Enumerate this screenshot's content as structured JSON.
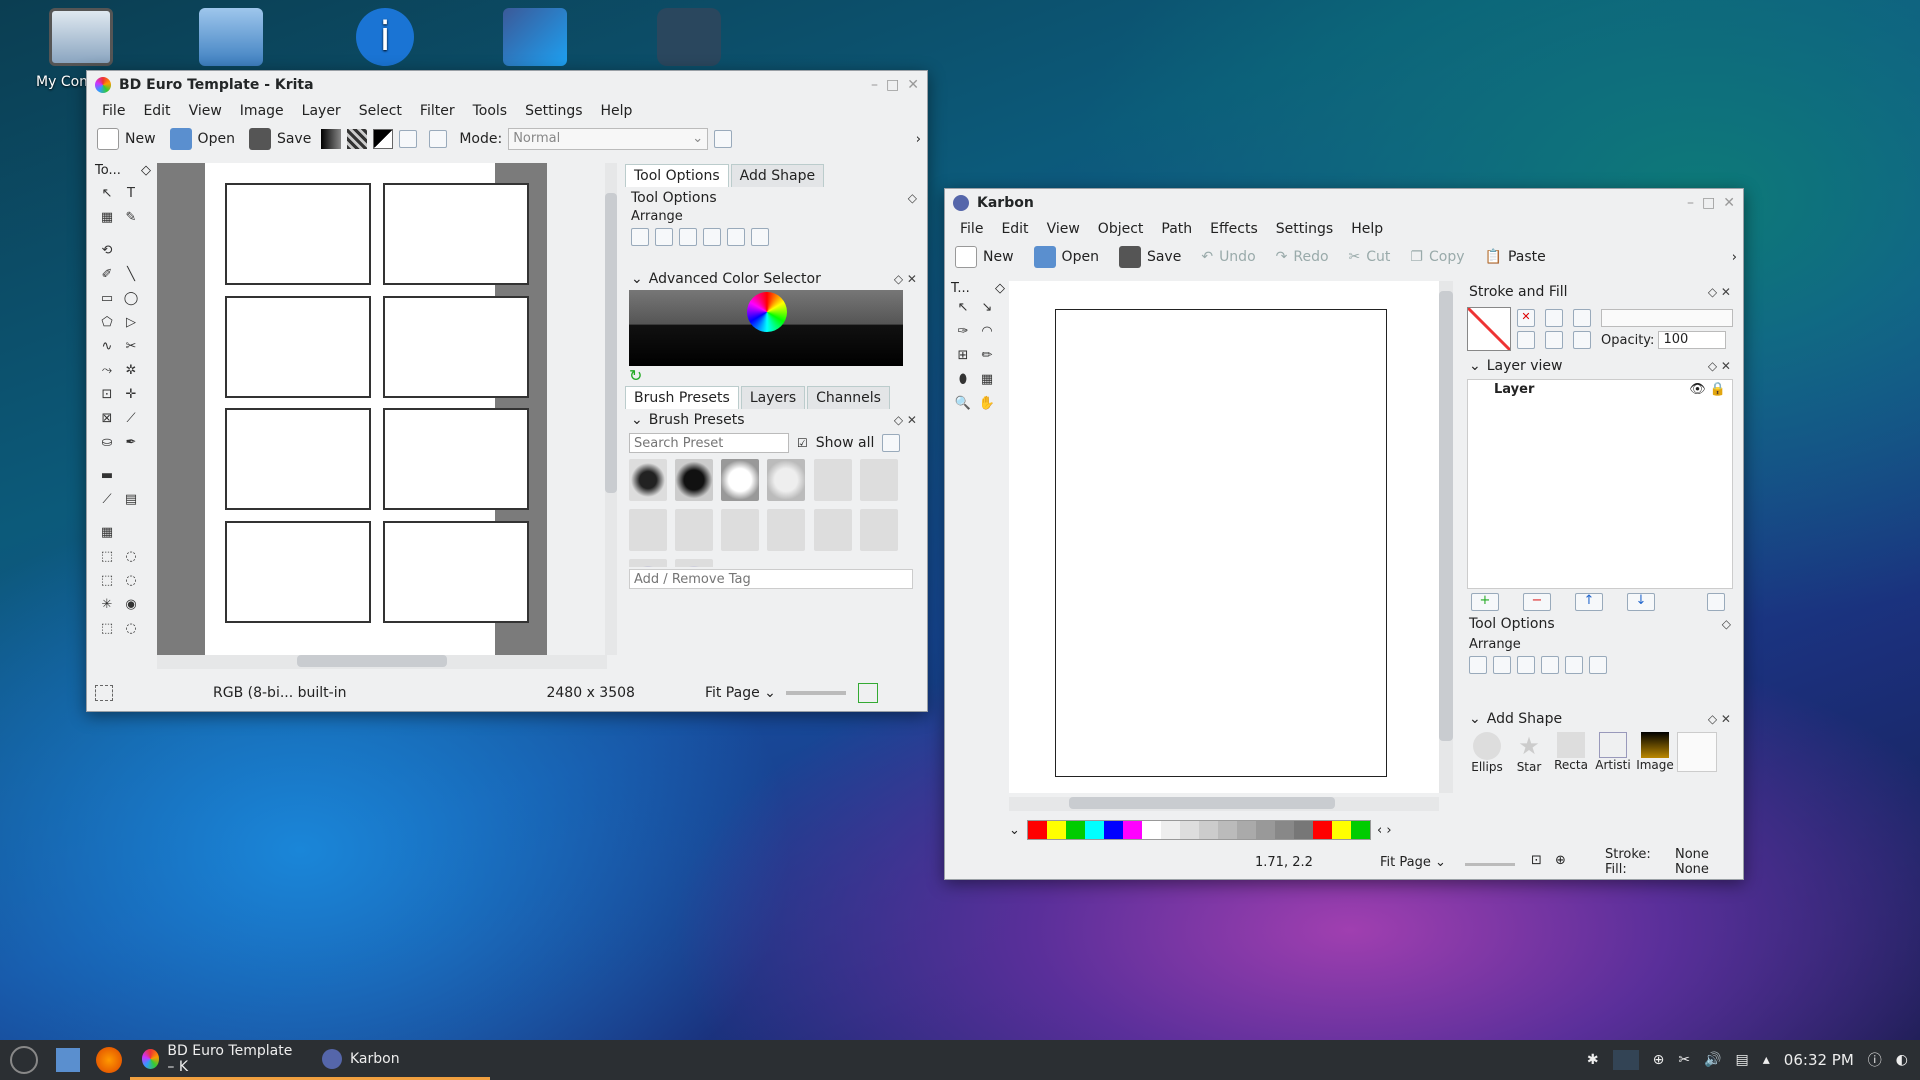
{
  "desktop": {
    "icons": [
      {
        "label": "My Com",
        "name": "my-computer"
      },
      {
        "label": "",
        "name": "network-folder"
      },
      {
        "label": "",
        "name": "info"
      },
      {
        "label": "",
        "name": "social"
      },
      {
        "label": "",
        "name": "steam"
      }
    ]
  },
  "krita": {
    "title": "BD Euro Template - Krita",
    "menu": [
      "File",
      "Edit",
      "View",
      "Image",
      "Layer",
      "Select",
      "Filter",
      "Tools",
      "Settings",
      "Help"
    ],
    "toolbar": {
      "new": "New",
      "open": "Open",
      "save": "Save",
      "mode_label": "Mode:",
      "mode_value": "Normal"
    },
    "toolbox_title": "To...",
    "tabs_top": [
      "Tool Options",
      "Add Shape"
    ],
    "tool_options": "Tool Options",
    "arrange": "Arrange",
    "color_selector": "Advanced Color Selector",
    "tabs_bottom": [
      "Brush Presets",
      "Layers",
      "Channels"
    ],
    "brush_presets": "Brush Presets",
    "search_placeholder": "Search Preset",
    "show_all": "Show all",
    "tag_placeholder": "Add / Remove Tag",
    "status": {
      "color": "RGB (8-bi... built-in",
      "size": "2480 x 3508",
      "zoom": "Fit Page"
    }
  },
  "karbon": {
    "title": "Karbon",
    "menu": [
      "File",
      "Edit",
      "View",
      "Object",
      "Path",
      "Effects",
      "Settings",
      "Help"
    ],
    "toolbar": {
      "new": "New",
      "open": "Open",
      "save": "Save",
      "undo": "Undo",
      "redo": "Redo",
      "cut": "Cut",
      "copy": "Copy",
      "paste": "Paste"
    },
    "toolbox_title": "T...",
    "stroke_fill": "Stroke and Fill",
    "opacity_label": "Opacity:",
    "opacity_value": "100",
    "layer_view": "Layer view",
    "layer_name": "Layer",
    "tool_options": "Tool Options",
    "arrange": "Arrange",
    "add_shape": "Add Shape",
    "shapes": [
      "Ellips",
      "Star",
      "Recta",
      "Artisti",
      "Image"
    ],
    "status": {
      "coords": "1.71, 2.2",
      "zoom": "Fit Page",
      "stroke_label": "Stroke:",
      "stroke_value": "None",
      "fill_label": "Fill:",
      "fill_value": "None"
    },
    "palette": [
      "#ff0000",
      "#ffff00",
      "#00cc00",
      "#00ffff",
      "#0000ff",
      "#ff00ff",
      "#ffffff",
      "#eeeeee",
      "#dddddd",
      "#cccccc",
      "#bbbbbb",
      "#aaaaaa",
      "#999999",
      "#888888",
      "#777777",
      "#ff0000",
      "#ffff00",
      "#00cc00"
    ]
  },
  "taskbar": {
    "tasks": [
      {
        "label": "BD Euro Template – K"
      },
      {
        "label": "Karbon"
      }
    ],
    "clock": "06:32 PM"
  }
}
